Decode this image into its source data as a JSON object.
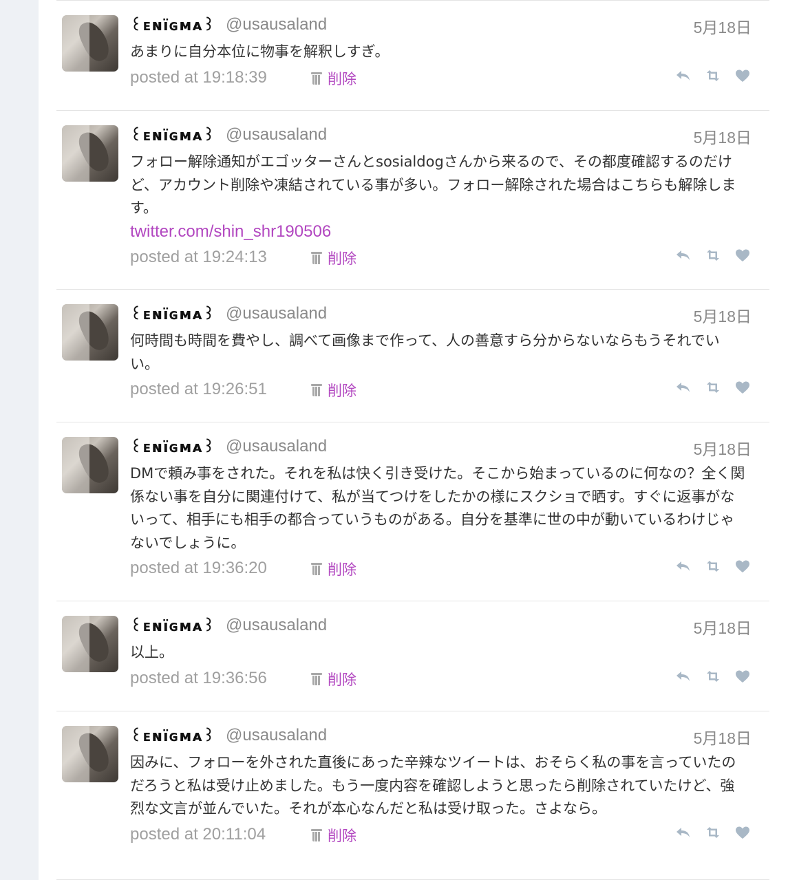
{
  "delete_label": "削除",
  "colors": {
    "link": "#b247c0",
    "muted": "#8a8a8a",
    "icon": "#a9b8c6"
  },
  "tweets": [
    {
      "display_name": "꒰ᴇɴïɢᴍᴀ꒱",
      "screen_name": "@usausaland",
      "date": "5月18日",
      "text": "あまりに自分本位に物事を解釈しすぎ。",
      "link": "",
      "posted": "posted at 19:18:39"
    },
    {
      "display_name": "꒰ᴇɴïɢᴍᴀ꒱",
      "screen_name": "@usausaland",
      "date": "5月18日",
      "text": "フォロー解除通知がエゴッターさんとsosialdogさんから来るので、その都度確認するのだけど、アカウント削除や凍結されている事が多い。フォロー解除された場合はこちらも解除します。",
      "link": "twitter.com/shin_shr190506",
      "posted": "posted at 19:24:13"
    },
    {
      "display_name": "꒰ᴇɴïɢᴍᴀ꒱",
      "screen_name": "@usausaland",
      "date": "5月18日",
      "text": "何時間も時間を費やし、調べて画像まで作って、人の善意すら分からないならもうそれでいい。",
      "link": "",
      "posted": "posted at 19:26:51"
    },
    {
      "display_name": "꒰ᴇɴïɢᴍᴀ꒱",
      "screen_name": "@usausaland",
      "date": "5月18日",
      "text": "DMで頼み事をされた。それを私は快く引き受けた。そこから始まっているのに何なの？全く関係ない事を自分に関連付けて、私が当てつけをしたかの様にスクショで晒す。すぐに返事がないって、相手にも相手の都合っていうものがある。自分を基準に世の中が動いているわけじゃないでしょうに。",
      "link": "",
      "posted": "posted at 19:36:20"
    },
    {
      "display_name": "꒰ᴇɴïɢᴍᴀ꒱",
      "screen_name": "@usausaland",
      "date": "5月18日",
      "text": "以上。",
      "link": "",
      "posted": "posted at 19:36:56"
    },
    {
      "display_name": "꒰ᴇɴïɢᴍᴀ꒱",
      "screen_name": "@usausaland",
      "date": "5月18日",
      "text": "因みに、フォローを外された直後にあった辛辣なツイートは、おそらく私の事を言っていたのだろうと私は受け止めました。もう一度内容を確認しようと思ったら削除されていたけど、強烈な文言が並んでいた。それが本心なんだと私は受け取った。さよなら。",
      "link": "",
      "posted": "posted at 20:11:04"
    }
  ]
}
